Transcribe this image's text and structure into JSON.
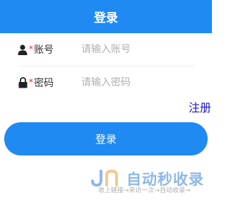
{
  "header": {
    "title": "登录"
  },
  "form": {
    "account": {
      "label": "账号",
      "required_mark": "*",
      "placeholder": "请输入账号",
      "value": "",
      "icon": "user-icon"
    },
    "password": {
      "label": "密码",
      "required_mark": "*",
      "placeholder": "请输入密码",
      "value": "",
      "icon": "lock-icon"
    }
  },
  "register": {
    "label": "注册"
  },
  "login_button": {
    "label": "登录"
  },
  "watermark": {
    "logo_letters": "JN",
    "main": "自动秒收录",
    "sub": "收上链接→来访一次→自动收录→"
  },
  "colors": {
    "primary": "#1e8af2",
    "register_link": "#1a14c8",
    "required": "#e53935",
    "placeholder": "#b0b0b0"
  }
}
